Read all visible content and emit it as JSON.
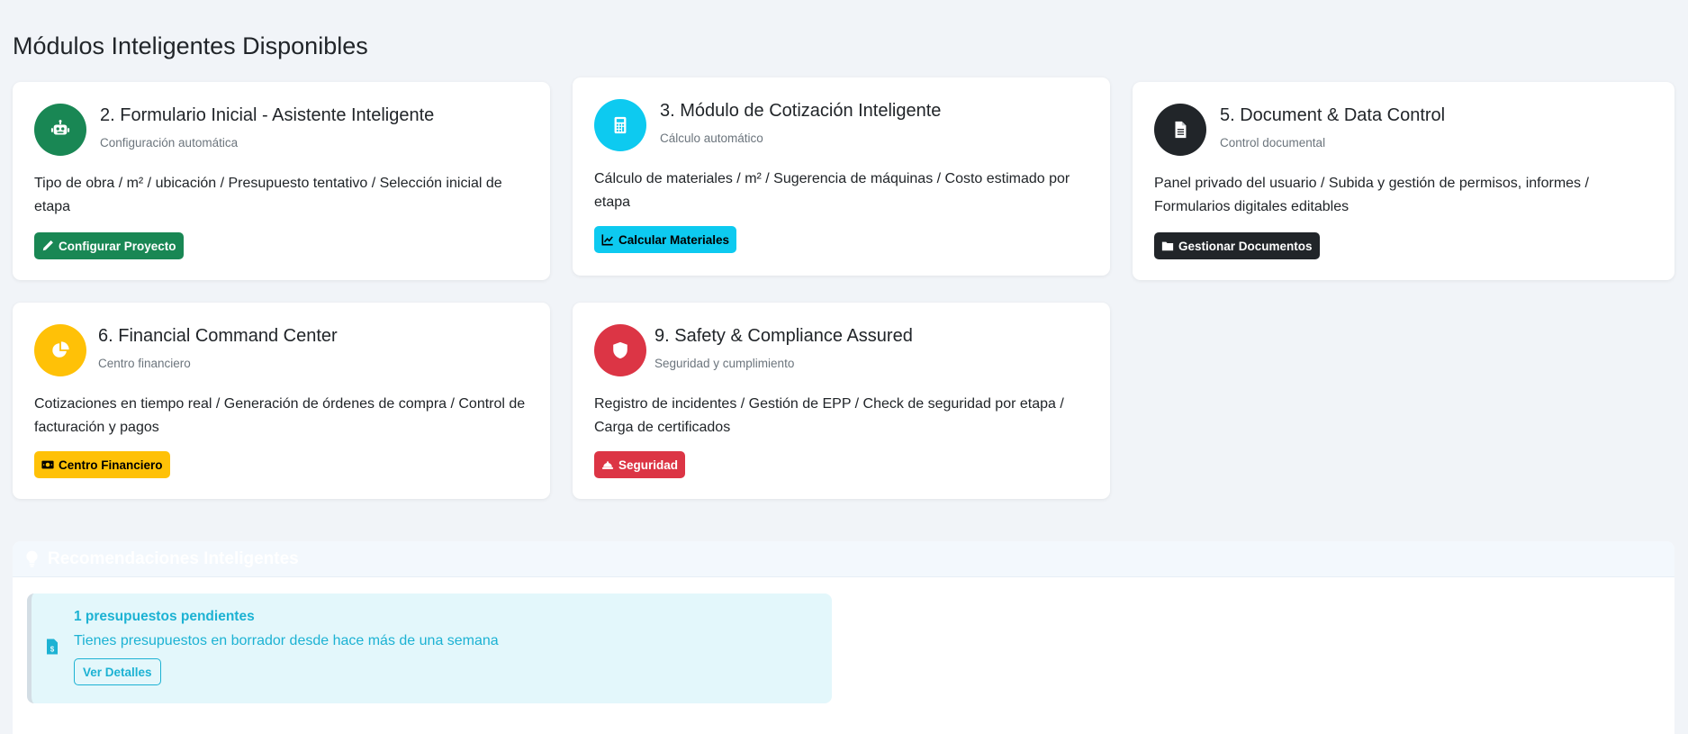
{
  "page": {
    "section_title": "Módulos Inteligentes Disponibles"
  },
  "modules": [
    {
      "title": "2. Formulario Inicial - Asistente Inteligente",
      "subtitle": "Configuración automática",
      "description": "Tipo de obra / m² / ubicación / Presupuesto tentativo / Selección inicial de etapa",
      "button_label": "Configurar Proyecto",
      "icon": "robot-icon",
      "button_icon": "pencil-icon",
      "color": "#198754",
      "button_text_color": "#ffffff"
    },
    {
      "title": "3. Módulo de Cotización Inteligente",
      "subtitle": "Cálculo automático",
      "description": "Cálculo de materiales / m² / Sugerencia de máquinas / Costo estimado por etapa",
      "button_label": "Calcular Materiales",
      "icon": "calculator-icon",
      "button_icon": "chart-line-icon",
      "color": "#0dcaf0",
      "button_text_color": "#000000"
    },
    {
      "title": "5. Document & Data Control",
      "subtitle": "Control documental",
      "description": "Panel privado del usuario / Subida y gestión de permisos, informes / Formularios digitales editables",
      "button_label": "Gestionar Documentos",
      "icon": "document-icon",
      "button_icon": "folder-icon",
      "color": "#212529",
      "button_text_color": "#ffffff"
    },
    {
      "title": "6. Financial Command Center",
      "subtitle": "Centro financiero",
      "description": "Cotizaciones en tiempo real / Generación de órdenes de compra / Control de facturación y pagos",
      "button_label": "Centro Financiero",
      "icon": "pie-chart-icon",
      "button_icon": "money-icon",
      "color": "#ffc107",
      "button_text_color": "#000000"
    },
    {
      "title": "9. Safety & Compliance Assured",
      "subtitle": "Seguridad y cumplimiento",
      "description": "Registro de incidentes / Gestión de EPP / Check de seguridad por etapa / Carga de certificados",
      "button_label": "Seguridad",
      "icon": "shield-icon",
      "button_icon": "hard-hat-icon",
      "color": "#dc3545",
      "button_text_color": "#ffffff"
    }
  ],
  "recommendations": {
    "header": "Recomendaciones Inteligentes",
    "header_icon": "lightbulb-icon",
    "alerts": [
      {
        "title": "1 presupuestos pendientes",
        "text": "Tienes presupuestos en borrador desde hace más de una semana",
        "button_label": "Ver Detalles",
        "icon": "invoice-dollar-icon",
        "color": "#1cb2d3"
      }
    ]
  }
}
